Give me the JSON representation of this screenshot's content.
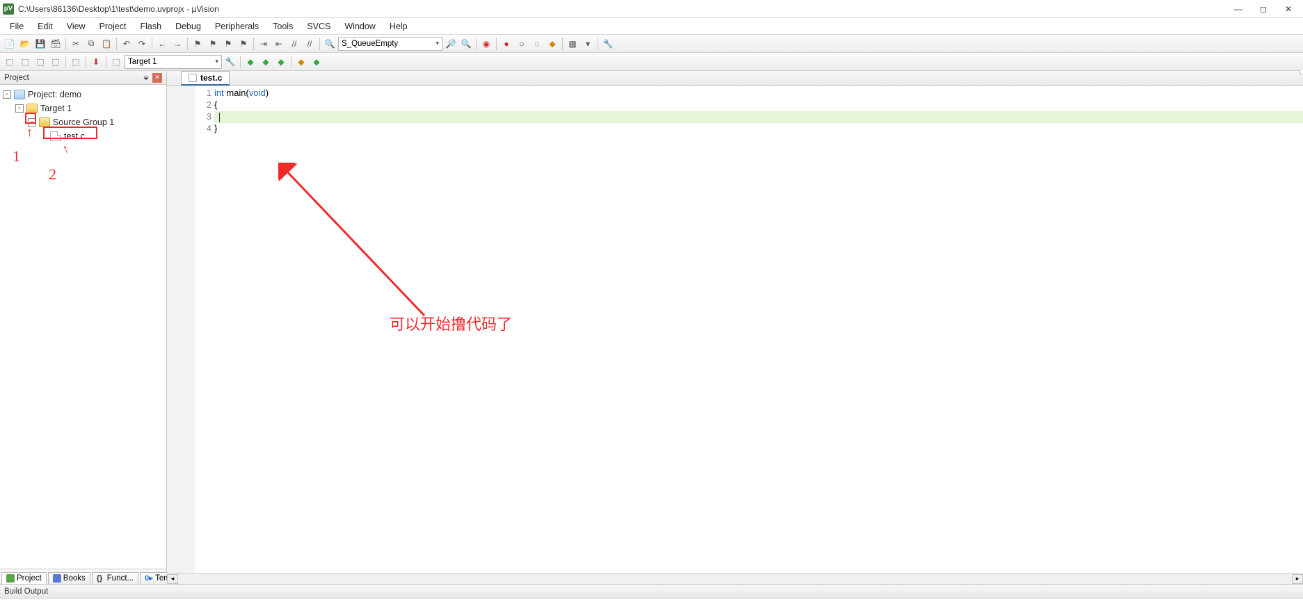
{
  "window": {
    "title": "C:\\Users\\86136\\Desktop\\1\\test\\demo.uvprojx - µVision",
    "app_icon_text": "µV"
  },
  "menu": [
    "File",
    "Edit",
    "View",
    "Project",
    "Flash",
    "Debug",
    "Peripherals",
    "Tools",
    "SVCS",
    "Window",
    "Help"
  ],
  "toolbar1": {
    "search_text": "S_QueueEmpty"
  },
  "toolbar2": {
    "target_text": "Target 1"
  },
  "project_panel": {
    "title": "Project",
    "tree": {
      "root": "Project: demo",
      "target": "Target 1",
      "group": "Source Group 1",
      "file": "test.c"
    },
    "tabs": [
      "Project",
      "Books",
      "Funct...",
      "Temp..."
    ]
  },
  "editor": {
    "tab_name": "test.c",
    "lines": [
      {
        "n": "1",
        "html": "int main(void)"
      },
      {
        "n": "2",
        "html": "{"
      },
      {
        "n": "3",
        "html": "  "
      },
      {
        "n": "4",
        "html": "}"
      }
    ]
  },
  "build_output": {
    "title": "Build Output"
  },
  "annotations": {
    "num1": "1",
    "num2": "2",
    "text": "可以开始撸代码了"
  }
}
